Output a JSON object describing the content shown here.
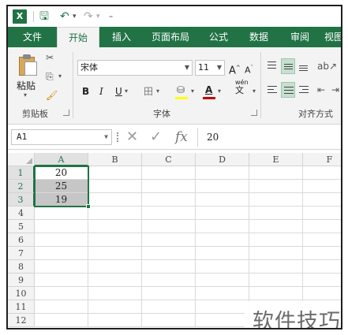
{
  "app": {
    "logo_letter": "X",
    "accent": "#217346",
    "selection_fill": "#c6c6c6"
  },
  "qat": {
    "save_icon": "save-icon",
    "undo_icon": "undo-icon",
    "redo_icon": "redo-icon",
    "customize_icon": "customize-qat-icon"
  },
  "tabs": [
    {
      "label": "文件"
    },
    {
      "label": "开始"
    },
    {
      "label": "插入"
    },
    {
      "label": "页面布局"
    },
    {
      "label": "公式"
    },
    {
      "label": "数据"
    },
    {
      "label": "审阅"
    },
    {
      "label": "视图"
    }
  ],
  "ribbon": {
    "clipboard": {
      "paste_label": "粘贴",
      "group_label": "剪贴板"
    },
    "font": {
      "name": "宋体",
      "size": "11",
      "grow": "A",
      "shrink": "A",
      "bold": "B",
      "italic": "I",
      "underline": "U",
      "border": "田",
      "phonetic": "wén",
      "phonetic_char": "文",
      "group_label": "字体",
      "highlight_color": "#ffff00",
      "font_color": "#c00000"
    },
    "alignment": {
      "group_label": "对齐方式"
    }
  },
  "formula_bar": {
    "name_box": "A1",
    "cancel": "✕",
    "enter": "✓",
    "fx": "fx",
    "value": "20"
  },
  "sheet": {
    "columns": [
      "A",
      "B",
      "C",
      "D",
      "E",
      "F"
    ],
    "rows": [
      "1",
      "2",
      "3",
      "4",
      "5",
      "6",
      "7",
      "8",
      "9",
      "10",
      "11",
      "12"
    ],
    "cells": {
      "A1": "20",
      "A2": "25",
      "A3": "19"
    },
    "selection": "A1:A3",
    "active_cell": "A1"
  },
  "watermark": "软件技巧"
}
